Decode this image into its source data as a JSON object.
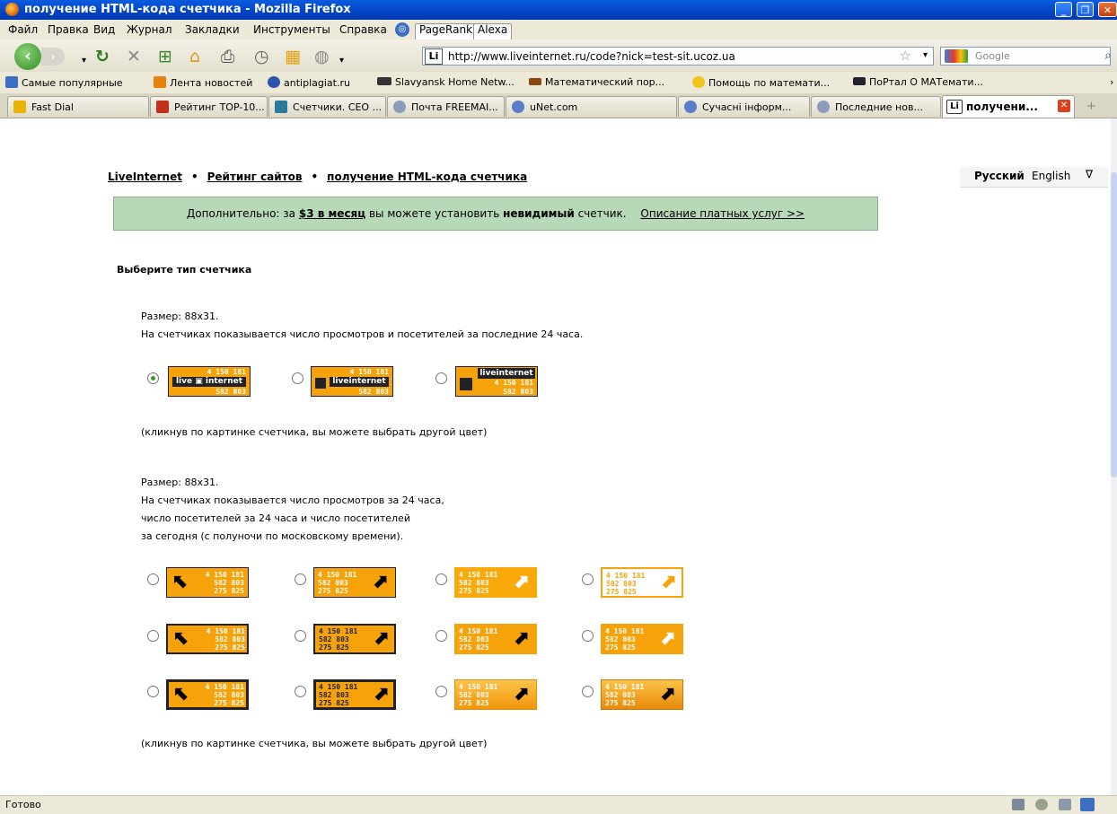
{
  "window": {
    "title": "получение HTML-кода счетчика - Mozilla Firefox"
  },
  "menu": [
    "Файл",
    "Правка",
    "Вид",
    "Журнал",
    "Закладки",
    "Инструменты",
    "Справка"
  ],
  "toolbar_pills": {
    "pagerank": "PageRank",
    "alexa": "Alexa"
  },
  "address": {
    "url": "http://www.liveinternet.ru/code?nick=test-sit.ucoz.ua",
    "site_icon": "Li"
  },
  "search": {
    "placeholder": "Google"
  },
  "bookmarks": [
    {
      "label": "Самые популярные",
      "icon": "star-folder-icon",
      "color": "#3b6fc2"
    },
    {
      "label": "Лента новостей",
      "icon": "rss-icon",
      "color": "#e7820c"
    },
    {
      "label": "antiplagiat.ru",
      "icon": "c-logo-icon",
      "color": "#2a55a8"
    },
    {
      "label": "Slavyansk Home Netw...",
      "icon": "cdc-icon",
      "color": "#333"
    },
    {
      "label": "Математический пор...",
      "icon": "book-icon",
      "color": "#8b4513"
    },
    {
      "label": "Помощь по математи...",
      "icon": "star-icon",
      "color": "#f0c419"
    },
    {
      "label": "ПоРтал О МАТемати...",
      "icon": "graduation-cap-icon",
      "color": "#233"
    }
  ],
  "tabs": [
    {
      "label": "Fast Dial",
      "color": "#e8b400"
    },
    {
      "label": "Рейтинг TOP-10...",
      "color": "#c0301a"
    },
    {
      "label": "Счетчики. СЕО ...",
      "color": "#2a7a9a"
    },
    {
      "label": "Почта FREEMAI...",
      "color": "#8a9cb8"
    },
    {
      "label": "uNet.com",
      "color": "#5a7fc8"
    },
    {
      "label": "Сучасні інформ...",
      "color": "#5a7fc8"
    },
    {
      "label": "Последние нов...",
      "color": "#8a9cb8"
    },
    {
      "label": "получени...",
      "color": "#fff"
    }
  ],
  "breadcrumb": {
    "home": "LiveInternet",
    "rating": "Рейтинг сайтов",
    "current": "получение HTML-кода счетчика",
    "sep": "•"
  },
  "lang": {
    "ru": "Русский",
    "en": "English"
  },
  "promo": {
    "prefix": "Дополнительно: за",
    "price": "$3 в месяц",
    "mid": "вы можете установить",
    "strong": "невидимый",
    "suffix": "счетчик.",
    "link": "Описание платных услуг >>"
  },
  "heading": "Выберите тип счетчика",
  "section1": {
    "size": "Размер: 88x31.",
    "desc": "На счетчиках показывается число просмотров и посетителей за последние 24 часа.",
    "note": "(кликнув по картинке счетчика, вы можете выбрать другой цвет)"
  },
  "section2": {
    "size": "Размер: 88x31.",
    "line1": "На счетчиках показывается число просмотров за 24 часа,",
    "line2": "число посетителей за 24 часа и число посетителей",
    "line3": "за сегодня (с полуночи по московскому времени).",
    "note": "(кликнув по картинке счетчика, вы можете выбрать другой цвет)"
  },
  "counter": {
    "views": "4 150 181",
    "visitors": "582 803",
    "today": "275 825",
    "brand_a": "live",
    "brand_b": "internet",
    "brand_full": "liveinternet"
  },
  "status": "Готово"
}
